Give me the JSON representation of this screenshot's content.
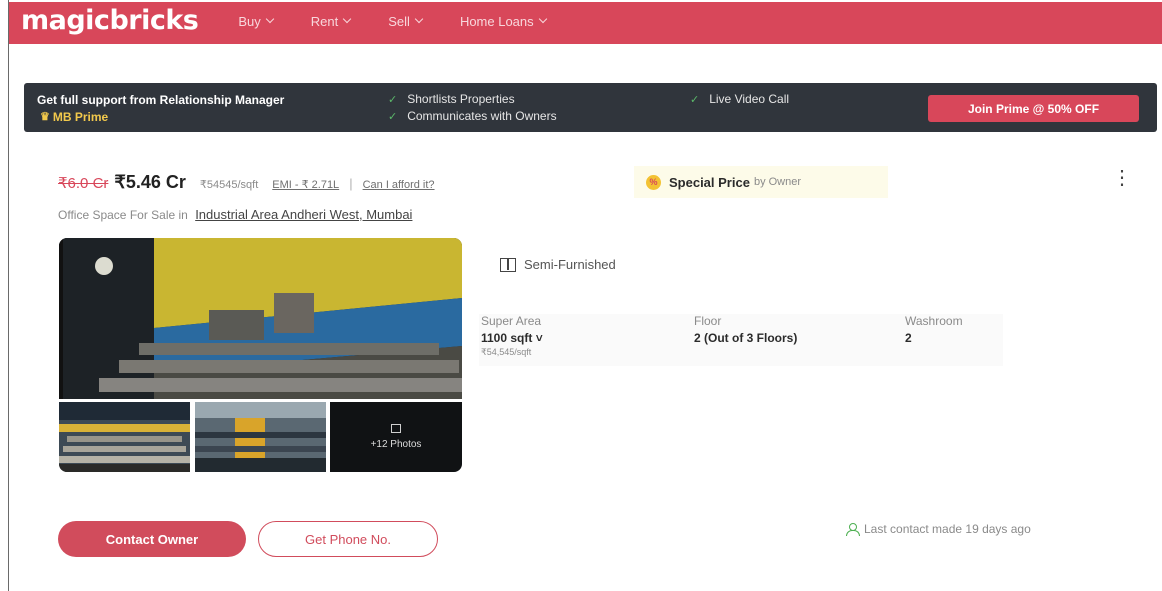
{
  "header": {
    "logo": "magicbricks",
    "nav": [
      "Buy",
      "Rent",
      "Sell",
      "Home Loans"
    ]
  },
  "prime_banner": {
    "text": "Get full support from Relationship Manager",
    "brand": "MB Prime",
    "benefits": [
      "Shortlists Properties",
      "Communicates with Owners",
      "Live Video Call"
    ],
    "cta": "Join Prime @ 50% OFF"
  },
  "listing": {
    "old_price": "₹6.0 Cr",
    "price": "₹5.46 Cr",
    "price_per_sqft": "₹54545/sqft",
    "emi": "EMI - ₹ 2.71L",
    "separator": "|",
    "afford": "Can I afford it?",
    "special_icon": "%",
    "special_label": "Special Price",
    "special_by": "by Owner",
    "subtitle_prefix": "Office Space For Sale in",
    "location": "Industrial Area Andheri West, Mumbai",
    "furnishing": "Semi-Furnished",
    "more_photos": "+12 Photos",
    "specs": {
      "super_area_label": "Super Area",
      "super_area_value": "1100 sqft ˅",
      "super_area_sub": "₹54,545/sqft",
      "floor_label": "Floor",
      "floor_value": "2 (Out of 3 Floors)",
      "washroom_label": "Washroom",
      "washroom_value": "2"
    },
    "contact_owner": "Contact Owner",
    "get_phone": "Get Phone No.",
    "last_contact": "Last contact made 19 days ago"
  },
  "colors": {
    "brand": "#d8475a",
    "banner_bg": "#30353c",
    "prime_gold": "#f2c94c"
  }
}
